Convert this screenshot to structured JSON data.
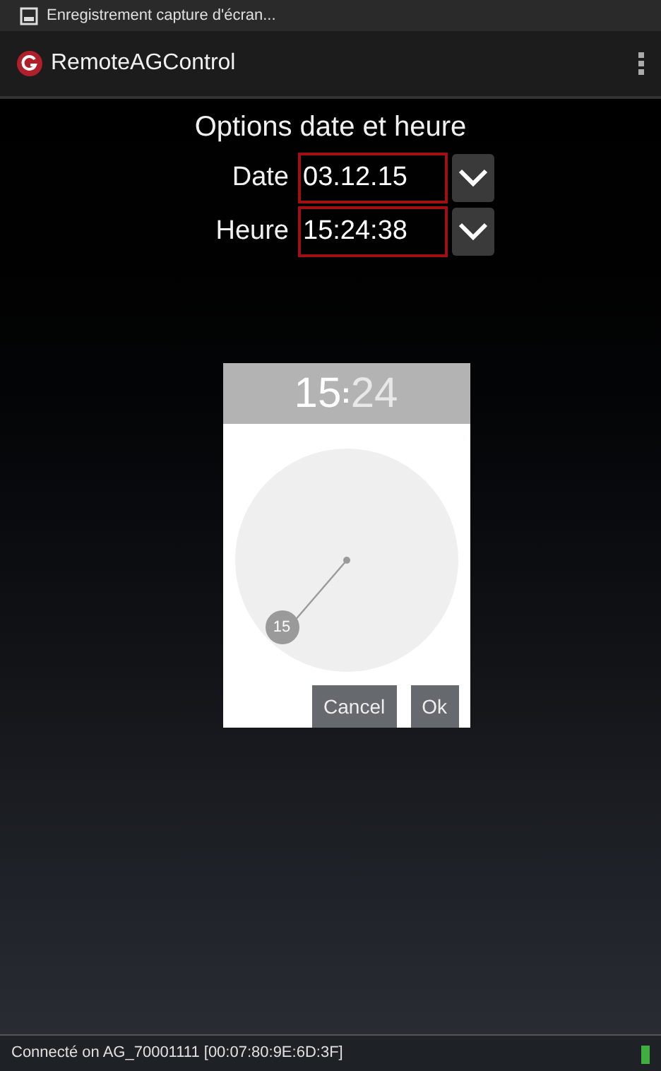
{
  "notification_bar": {
    "text": "Enregistrement capture d'écran..."
  },
  "app_bar": {
    "title": "RemoteAGControl"
  },
  "heading": "Options date et heure",
  "fields": [
    {
      "label": "Date",
      "value": "03.12.15"
    },
    {
      "label": "Heure",
      "value": "15:24:38"
    }
  ],
  "time_picker": {
    "hours": {
      "text": "15",
      "selected": true
    },
    "separator": ":",
    "minutes": {
      "text": "24",
      "selected": false
    },
    "hand_label": "15",
    "buttons": [
      "Cancel",
      "Ok"
    ]
  },
  "status_bar": {
    "text": "Connecté on AG_70001111 [00:07:80:9E:6D:3F]"
  }
}
